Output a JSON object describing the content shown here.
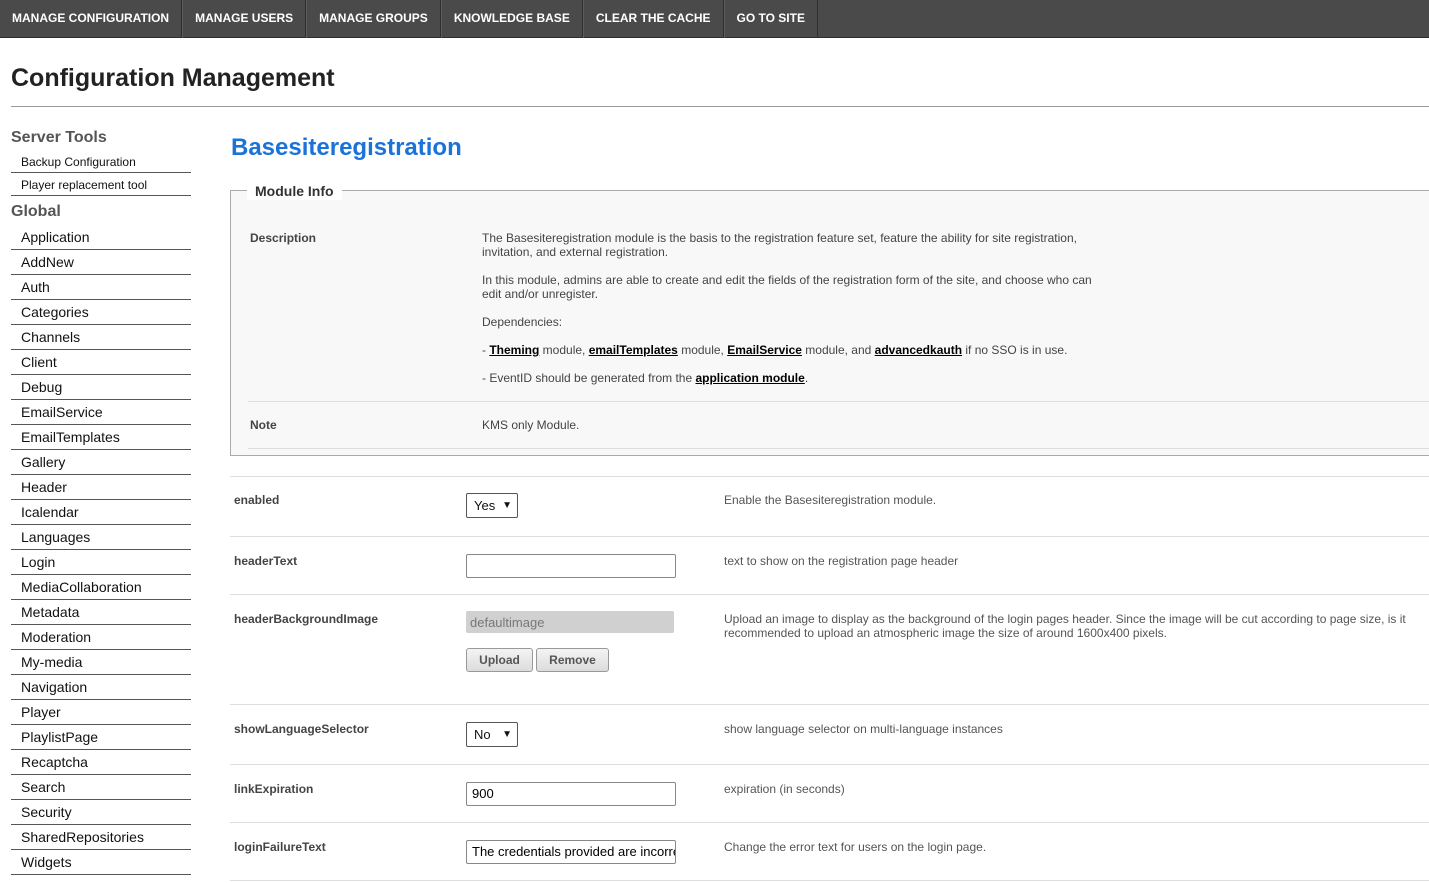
{
  "topnav": [
    {
      "label": "Manage Configuration"
    },
    {
      "label": "Manage Users"
    },
    {
      "label": "Manage Groups"
    },
    {
      "label": "Knowledge Base"
    },
    {
      "label": "Clear the Cache"
    },
    {
      "label": "Go to Site"
    }
  ],
  "page_title": "Configuration Management",
  "sidebar": {
    "server_tools_heading": "Server Tools",
    "server_tools": [
      "Backup Configuration",
      "Player replacement tool"
    ],
    "global_heading": "Global",
    "global": [
      "Application",
      "AddNew",
      "Auth",
      "Categories",
      "Channels",
      "Client",
      "Debug",
      "EmailService",
      "EmailTemplates",
      "Gallery",
      "Header",
      "Icalendar",
      "Languages",
      "Login",
      "MediaCollaboration",
      "Metadata",
      "Moderation",
      "My-media",
      "Navigation",
      "Player",
      "PlaylistPage",
      "Recaptcha",
      "Search",
      "Security",
      "SharedRepositories",
      "Widgets"
    ]
  },
  "module": {
    "title": "Basesiteregistration",
    "info_legend": "Module Info",
    "description_label": "Description",
    "desc_p1": "The Basesiteregistration module is the basis to the registration feature set, feature the ability for site registration, invitation, and external registration.",
    "desc_p2": "In this module, admins are able to create and edit the fields of the registration form of the site, and choose who can edit and/or unregister.",
    "desc_p3": "Dependencies:",
    "dep1": {
      "prefix": "- ",
      "link1": "Theming",
      "t1": " module, ",
      "link2": "emailTemplates",
      "t2": " module, ",
      "link3": "EmailService",
      "t3": " module, and ",
      "link4": "advancedkauth",
      "t4": " if no SSO is in use."
    },
    "dep2": {
      "prefix": "- EventID should be generated from the ",
      "link": "application module",
      "suffix": "."
    },
    "note_label": "Note",
    "note_text": "KMS only Module."
  },
  "config": {
    "enabled": {
      "name": "enabled",
      "value": "Yes",
      "desc": "Enable the Basesiteregistration module."
    },
    "headerText": {
      "name": "headerText",
      "value": "",
      "desc": "text to show on the registration page header"
    },
    "headerBackgroundImage": {
      "name": "headerBackgroundImage",
      "value": "defaultimage",
      "upload": "Upload",
      "remove": "Remove",
      "desc": "Upload an image to display as the background of the login pages header. Since the image will be cut according to page size, is it recommended to upload an atmospheric image the size of around 1600x400 pixels."
    },
    "showLanguageSelector": {
      "name": "showLanguageSelector",
      "value": "No",
      "desc": "show language selector on multi-language instances"
    },
    "linkExpiration": {
      "name": "linkExpiration",
      "value": "900",
      "desc": "expiration (in seconds)"
    },
    "loginFailureText": {
      "name": "loginFailureText",
      "value": "The credentials provided are incorrect",
      "desc": "Change the error text for users on the login page."
    }
  }
}
